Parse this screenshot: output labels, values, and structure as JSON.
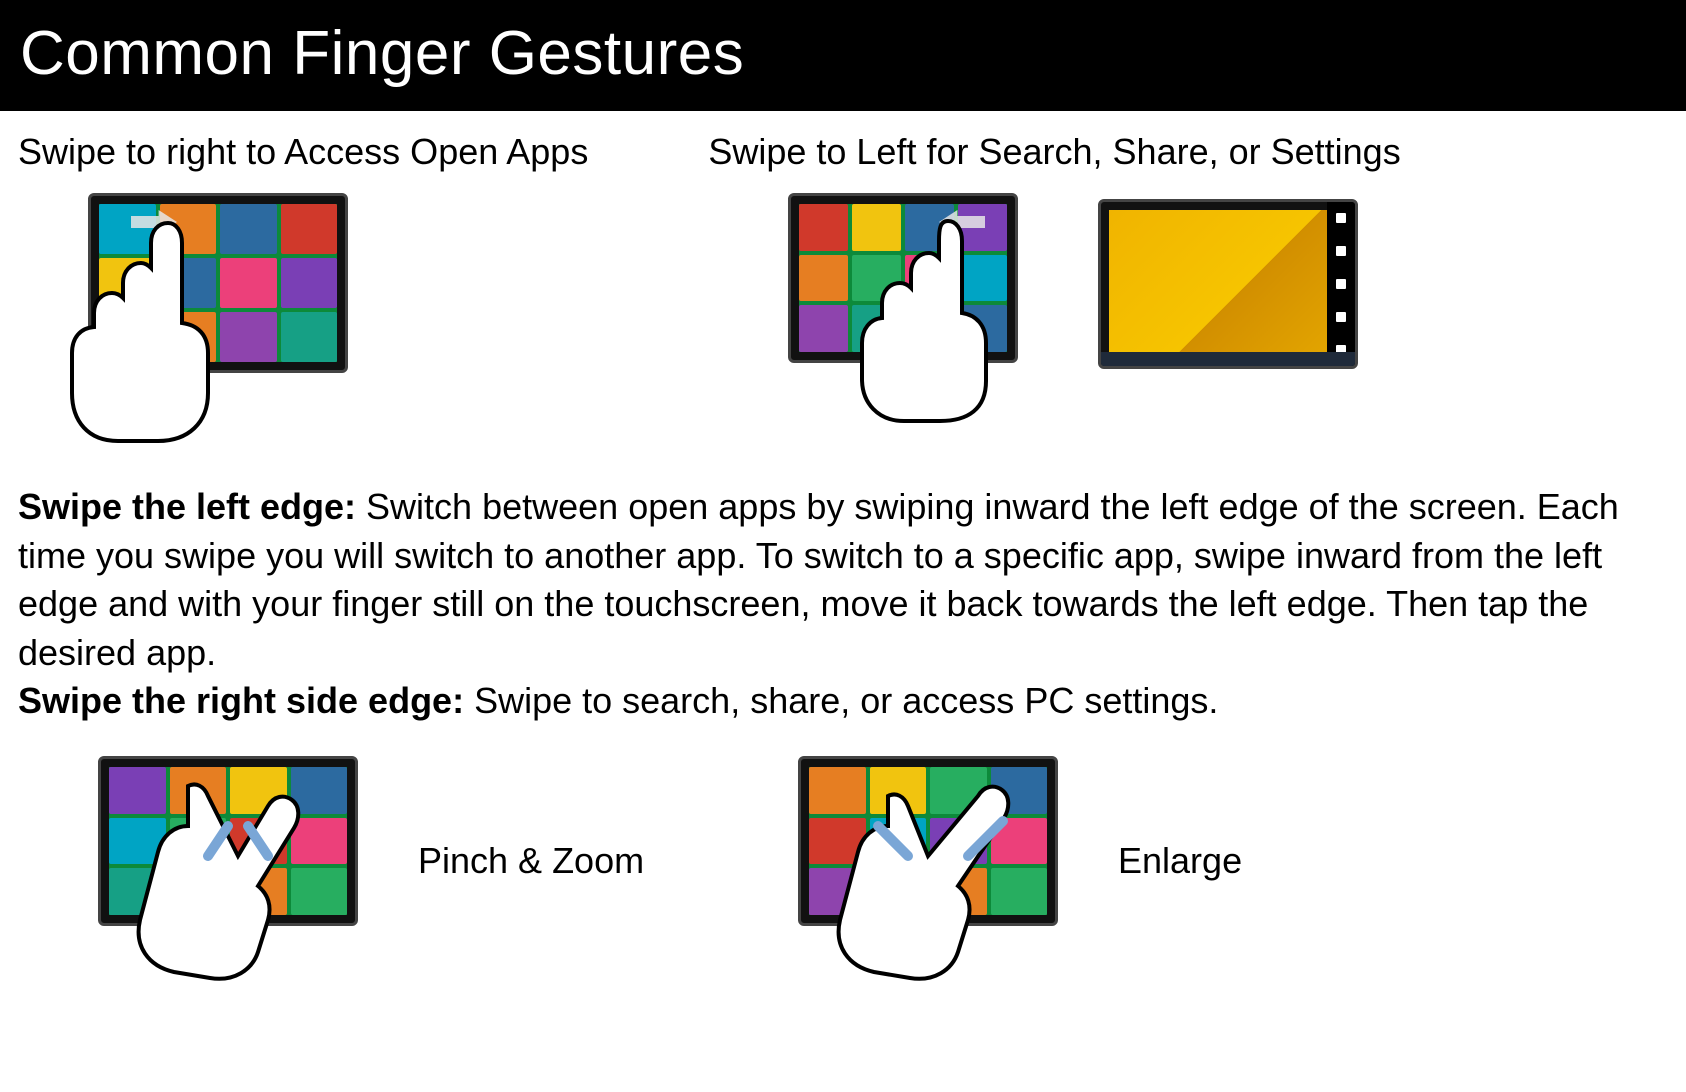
{
  "header": {
    "title": "Common Finger Gestures"
  },
  "section1": {
    "swipe_right_heading": "Swipe to right to Access Open Apps",
    "swipe_left_heading": "Swipe to Left for Search, Share, or Settings"
  },
  "body": {
    "left_edge_label": "Swipe the left edge:",
    "left_edge_text": " Switch between open apps by swiping inward the left edge of the screen. Each time you swipe you will switch to another app. To switch to a specific app, swipe inward from the left edge and with your finger still on the touchscreen, move it back towards the left edge. Then tap the desired app.",
    "right_edge_label": "Swipe the right side edge:",
    "right_edge_text": " Swipe to search, share, or access PC settings."
  },
  "section2": {
    "pinch_label": "Pinch & Zoom",
    "enlarge_label": "Enlarge"
  }
}
